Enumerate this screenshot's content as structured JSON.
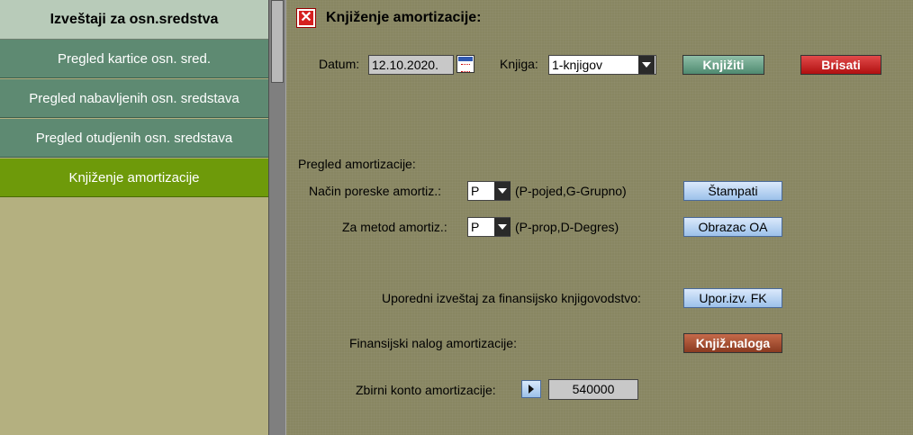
{
  "sidebar": {
    "header": "Izveštaji za osn.sredstva",
    "items": [
      {
        "label": "Pregled kartice osn. sred."
      },
      {
        "label": "Pregled nabavljenih osn. sredstava"
      },
      {
        "label": "Pregled otudjenih osn. sredstava"
      },
      {
        "label": "Knjiženje amortizacije"
      }
    ]
  },
  "main": {
    "title": "Knjiženje amortizacije:",
    "datum_label": "Datum:",
    "datum_value": "12.10.2020.",
    "knjiga_label": "Knjiga:",
    "knjiga_value": "1-knjigov",
    "knjiziti_button": "Knjižiti",
    "brisati_button": "Brisati",
    "pregled_label": "Pregled amortizacije:",
    "nacin_label": "Način poreske amortiz.:",
    "nacin_value": "P",
    "nacin_hint": "(P-pojed,G-Grupno)",
    "stampati_button": "Štampati",
    "metod_label": "Za metod amortiz.:",
    "metod_value": "P",
    "metod_hint": "(P-prop,D-Degres)",
    "obrazac_button": "Obrazac OA",
    "uporedni_label": "Uporedni izveštaj za finansijsko knjigovodstvo:",
    "upor_button": "Upor.izv. FK",
    "nalog_label": "Finansijski nalog amortizacije:",
    "nalog_button": "Knjiž.naloga",
    "konto_label": "Zbirni konto amortizacije:",
    "konto_value": "540000"
  },
  "colors": {
    "sidebar_item": "#5e8a72",
    "sidebar_active": "#6e9a0a",
    "main_bg": "#888662",
    "danger": "#c01818"
  }
}
